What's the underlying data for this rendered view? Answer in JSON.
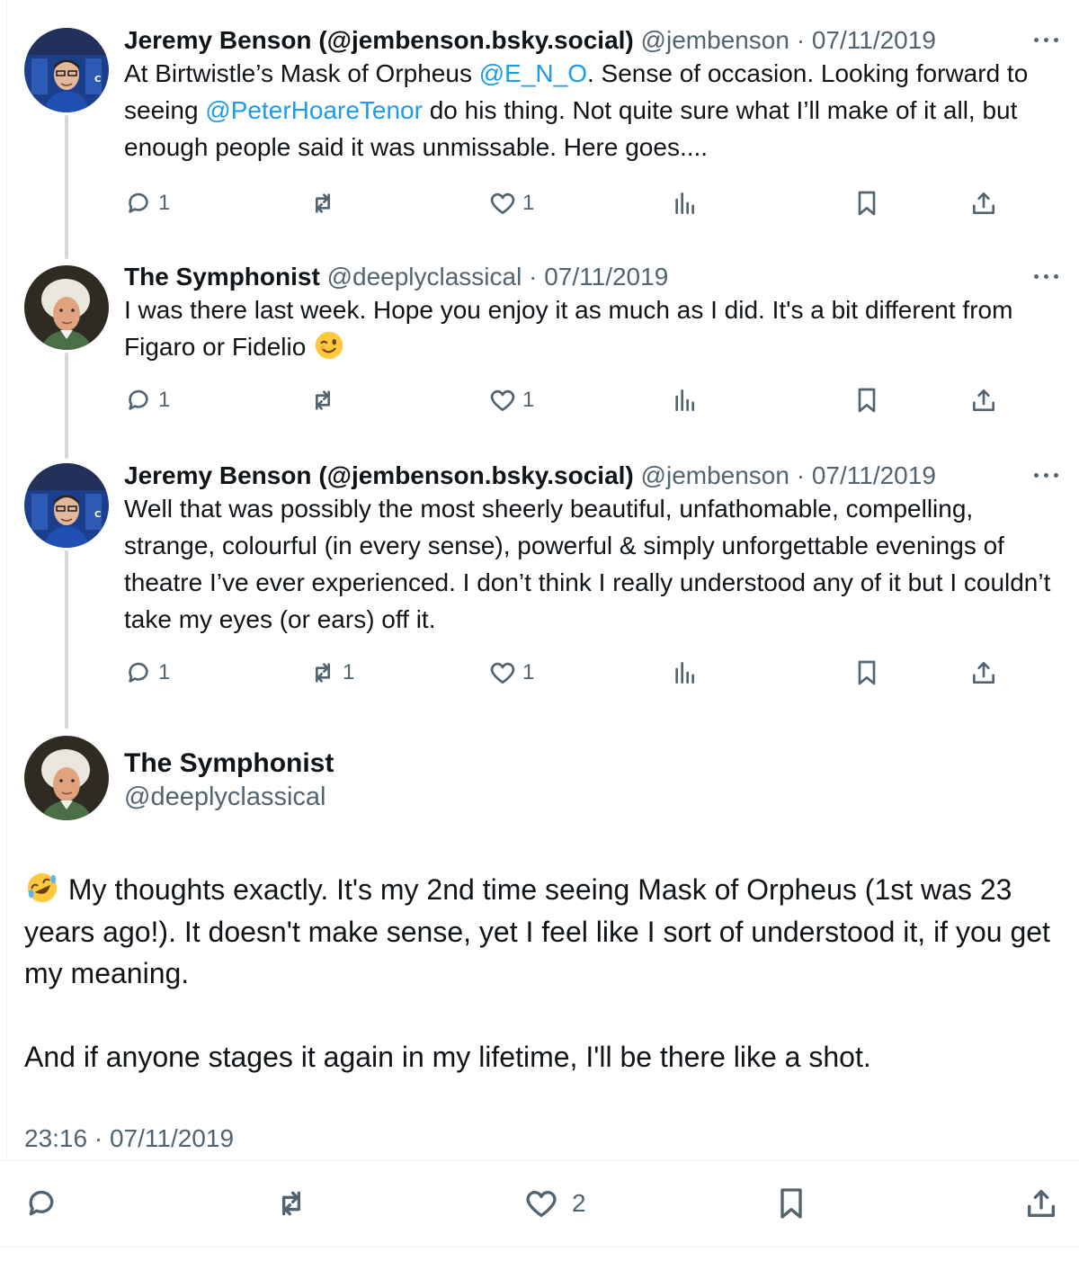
{
  "thread": [
    {
      "author": "Jeremy Benson (@jembenson.bsky.social)",
      "handle": "@jembenson",
      "date": "07/11/2019",
      "text_before_mention1": "At Birtwistle’s Mask of Orpheus ",
      "mention1": "@E_N_O",
      "text_after_mention1": ". Sense of occasion. Looking forward to seeing ",
      "mention2": "@PeterHoareTenor",
      "text_after_mention2": " do his thing. Not quite sure what I’ll make of it all, but enough people said it was unmissable. Here goes....",
      "replies": "1",
      "reposts": "",
      "likes": "1"
    },
    {
      "author": "The Symphonist",
      "handle": "@deeplyclassical",
      "date": "07/11/2019",
      "text": "I was there last week. Hope you enjoy it as much as I did. It's a bit different from Figaro or Fidelio ",
      "emoji": "winking-face",
      "replies": "1",
      "reposts": "",
      "likes": "1"
    },
    {
      "author": "Jeremy Benson (@jembenson.bsky.social)",
      "handle": "@jembenson",
      "date": "07/11/2019",
      "text": "Well that was possibly the most sheerly beautiful, unfathomable, compelling, strange, colourful (in every sense), powerful & simply unforgettable evenings of theatre I’ve ever experienced. I don’t think I really understood any of it but I couldn’t take my eyes (or ears) off it.",
      "replies": "1",
      "reposts": "1",
      "likes": "1"
    }
  ],
  "main_post": {
    "author": "The Symphonist",
    "handle": "@deeplyclassical",
    "emoji": "rolling-on-floor-laughing",
    "paragraph1": " My thoughts exactly. It's my 2nd time seeing Mask of Orpheus (1st was 23 years ago!). It doesn't make sense, yet I feel like I sort of understood it, if you get my meaning.",
    "paragraph2": "And if anyone stages it again in my lifetime, I'll be there like a shot.",
    "time": "23:16",
    "date": "07/11/2019",
    "likes": "2"
  },
  "separator": " · ",
  "colors": {
    "text": "#0f1419",
    "secondary": "#536471",
    "link": "#1d9bf0",
    "thread_line": "#cfd9de"
  }
}
